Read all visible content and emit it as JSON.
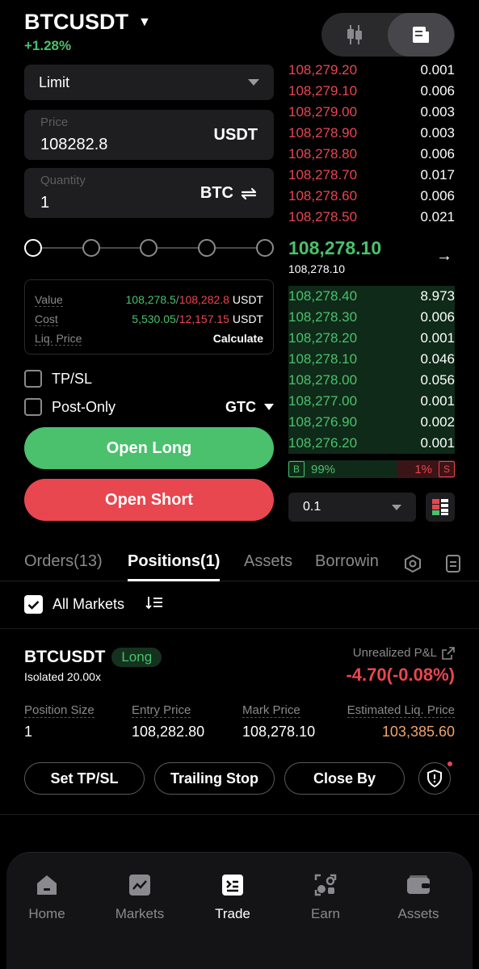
{
  "header": {
    "symbol": "BTCUSDT",
    "change": "+1.28%"
  },
  "form": {
    "order_type": "Limit",
    "price_label": "Price",
    "price_value": "108282.8",
    "price_unit": "USDT",
    "qty_label": "Quantity",
    "qty_value": "1",
    "qty_unit": "BTC",
    "slider_level": 0,
    "value_label": "Value",
    "value_a": "108,278.5",
    "value_sep": "/",
    "value_b": "108,282.8",
    "value_unit": "USDT",
    "cost_label": "Cost",
    "cost_a": "5,530.05",
    "cost_sep": "/",
    "cost_b": "12,157.15",
    "cost_unit": "USDT",
    "liq_label": "Liq. Price",
    "liq_action": "Calculate",
    "tpsl_label": "TP/SL",
    "postonly_label": "Post-Only",
    "tif": "GTC",
    "open_long": "Open Long",
    "open_short": "Open Short"
  },
  "orderbook": {
    "asks": [
      {
        "price": "108,279.20",
        "qty": "0.001"
      },
      {
        "price": "108,279.10",
        "qty": "0.006"
      },
      {
        "price": "108,279.00",
        "qty": "0.003"
      },
      {
        "price": "108,278.90",
        "qty": "0.003"
      },
      {
        "price": "108,278.80",
        "qty": "0.006"
      },
      {
        "price": "108,278.70",
        "qty": "0.017"
      },
      {
        "price": "108,278.60",
        "qty": "0.006"
      },
      {
        "price": "108,278.50",
        "qty": "0.021"
      }
    ],
    "mid_price": "108,278.10",
    "mid_sub": "108,278.10",
    "bids": [
      {
        "price": "108,278.40",
        "qty": "8.973"
      },
      {
        "price": "108,278.30",
        "qty": "0.006"
      },
      {
        "price": "108,278.20",
        "qty": "0.001"
      },
      {
        "price": "108,278.10",
        "qty": "0.046"
      },
      {
        "price": "108,278.00",
        "qty": "0.056"
      },
      {
        "price": "108,277.00",
        "qty": "0.001"
      },
      {
        "price": "108,276.90",
        "qty": "0.002"
      },
      {
        "price": "108,276.20",
        "qty": "0.001"
      }
    ],
    "buy_tag": "B",
    "buy_pct": "99%",
    "sell_pct": "1%",
    "sell_tag": "S",
    "depth": "0.1"
  },
  "tabs": [
    "Orders(13)",
    "Positions(1)",
    "Assets",
    "Borrowin"
  ],
  "filter": {
    "label": "All Markets"
  },
  "position": {
    "symbol": "BTCUSDT",
    "side": "Long",
    "mode": "Isolated 20.00x",
    "upl_label": "Unrealized P&L",
    "upl_value": "-4.70(-0.08%)",
    "size_label": "Position Size",
    "size": "1",
    "entry_label": "Entry Price",
    "entry": "108,282.80",
    "mark_label": "Mark Price",
    "mark": "108,278.10",
    "liq_label": "Estimated Liq. Price",
    "liq": "103,385.60",
    "btn_tpsl": "Set TP/SL",
    "btn_trailing": "Trailing Stop",
    "btn_close": "Close By"
  },
  "nav": [
    {
      "label": "Home",
      "icon": "home-icon"
    },
    {
      "label": "Markets",
      "icon": "chart-icon"
    },
    {
      "label": "Trade",
      "icon": "trade-icon"
    },
    {
      "label": "Earn",
      "icon": "earn-icon"
    },
    {
      "label": "Assets",
      "icon": "wallet-icon"
    }
  ],
  "colors": {
    "green": "#4bc06d",
    "red": "#e8474f",
    "orange": "#f0a46c",
    "bg": "#000000"
  }
}
